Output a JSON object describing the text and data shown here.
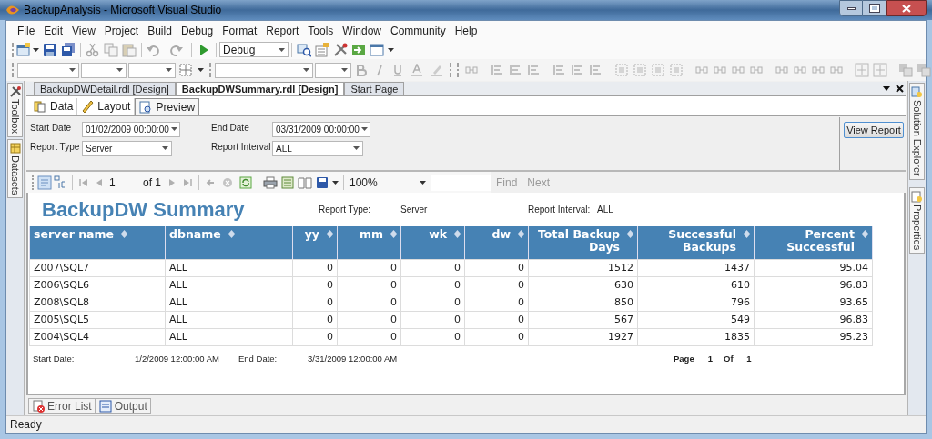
{
  "window": {
    "title": "BackupAnalysis - Microsoft Visual Studio"
  },
  "menu": [
    "File",
    "Edit",
    "View",
    "Project",
    "Build",
    "Debug",
    "Format",
    "Report",
    "Tools",
    "Window",
    "Community",
    "Help"
  ],
  "toolbar": {
    "configuration": "Debug"
  },
  "side_tabs_left": [
    "Toolbox",
    "Datasets"
  ],
  "side_tabs_right": [
    "Solution Explorer",
    "Properties"
  ],
  "document_tabs": [
    {
      "label": "BackupDWDetail.rdl [Design]",
      "selected": false
    },
    {
      "label": "BackupDWSummary.rdl [Design]",
      "selected": true
    },
    {
      "label": "Start Page",
      "selected": false
    }
  ],
  "view_tabs": [
    {
      "label": "Data",
      "selected": false
    },
    {
      "label": "Layout",
      "selected": false
    },
    {
      "label": "Preview",
      "selected": true
    }
  ],
  "parameters": [
    {
      "label": "Start Date",
      "value": "01/02/2009 00:00:00"
    },
    {
      "label": "End Date",
      "value": "03/31/2009 00:00:00"
    },
    {
      "label": "Report Type",
      "value": "Server"
    },
    {
      "label": "Report Interval",
      "value": "ALL"
    }
  ],
  "view_report_button": "View Report",
  "report_toolbar": {
    "page": "1",
    "page_count": "of 1",
    "zoom": "100%",
    "links": [
      {
        "label": "Find",
        "disabled": true
      },
      {
        "label": "Next",
        "disabled": true
      }
    ]
  },
  "report": {
    "title": "BackupDW Summary",
    "meta": [
      {
        "label": "Report Type:",
        "value": "Server"
      },
      {
        "label": "Report Interval:",
        "value": "ALL"
      }
    ],
    "table": {
      "columns": [
        "server name",
        "dbname",
        "yy",
        "mm",
        "wk",
        "dw",
        "Total Backup Days",
        "Successful Backups",
        "Percent Successful"
      ],
      "rows": [
        [
          "Z007\\SQL7",
          "ALL",
          "0",
          "0",
          "0",
          "0",
          "1512",
          "1437",
          "95.04"
        ],
        [
          "Z006\\SQL6",
          "ALL",
          "0",
          "0",
          "0",
          "0",
          "630",
          "610",
          "96.83"
        ],
        [
          "Z008\\SQL8",
          "ALL",
          "0",
          "0",
          "0",
          "0",
          "850",
          "796",
          "93.65"
        ],
        [
          "Z005\\SQL5",
          "ALL",
          "0",
          "0",
          "0",
          "0",
          "567",
          "549",
          "96.83"
        ],
        [
          "Z004\\SQL4",
          "ALL",
          "0",
          "0",
          "0",
          "0",
          "1927",
          "1835",
          "95.23"
        ]
      ]
    },
    "footer": {
      "start_label": "Start Date:",
      "start_value": "1/2/2009 12:00:00 AM",
      "end_label": "End Date:",
      "end_value": "3/31/2009 12:00:00 AM",
      "page_label": "Page",
      "page": "1",
      "of_label": "Of",
      "page_count": "1"
    }
  },
  "bottom_tabs": [
    "Error List",
    "Output"
  ],
  "status_bar": "Ready"
}
